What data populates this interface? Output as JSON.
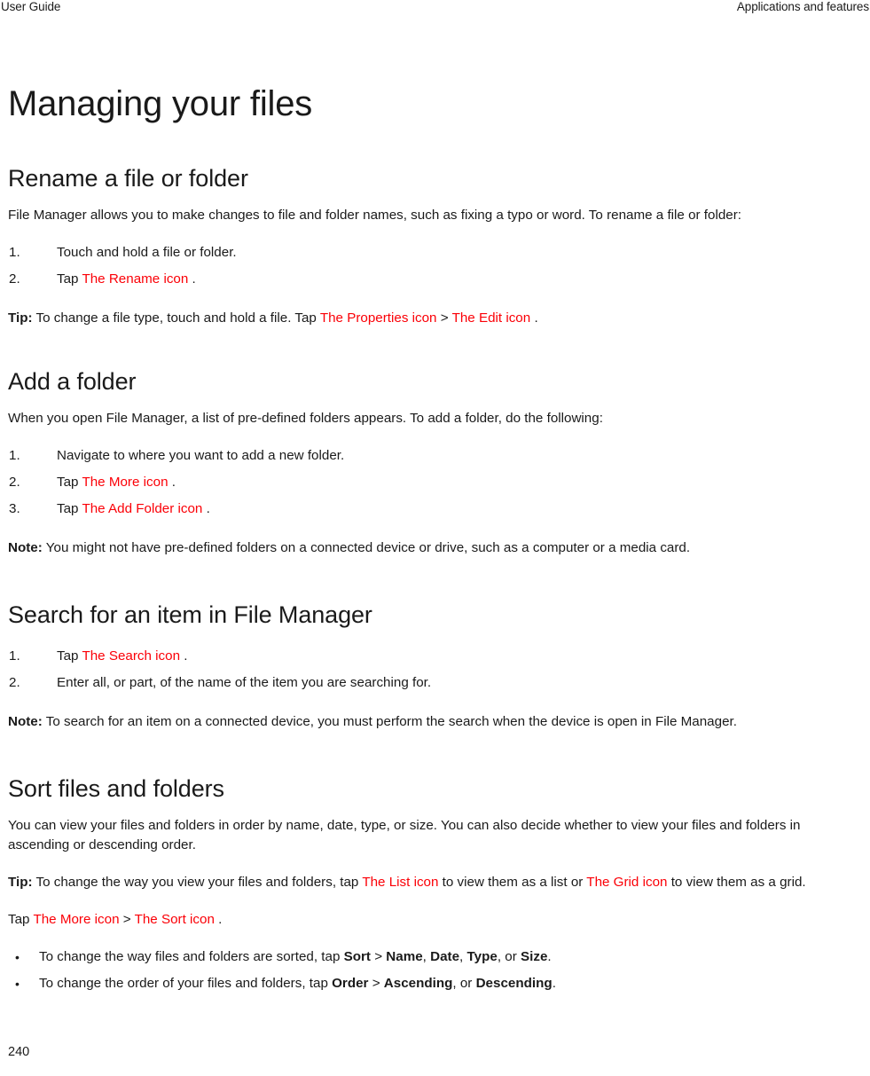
{
  "header": {
    "left": "User Guide",
    "right": "Applications and features"
  },
  "page_title": "Managing your files",
  "colors": {
    "icon_reference_red": "#fb0007",
    "body_text": "#1a1a1a",
    "background": "#ffffff"
  },
  "sections": {
    "rename": {
      "heading": "Rename a file or folder",
      "intro": "File Manager allows you to make changes to file and folder names, such as fixing a typo or word. To rename a file or folder:",
      "steps": [
        {
          "num": "1.",
          "pre": "Touch and hold a file or folder.",
          "icon": "",
          "post": ""
        },
        {
          "num": "2.",
          "pre": "Tap ",
          "icon": "The Rename icon",
          "post": " ."
        }
      ],
      "tip_label": "Tip:",
      "tip_pre": " To change a file type, touch and hold a file. Tap ",
      "tip_icon1": "The Properties icon",
      "tip_sep": " > ",
      "tip_icon2": "The Edit icon",
      "tip_post": " ."
    },
    "add_folder": {
      "heading": "Add a folder",
      "intro": "When you open File Manager, a list of pre-defined folders appears. To add a folder, do the following:",
      "steps": [
        {
          "num": "1.",
          "pre": "Navigate to where you want to add a new folder.",
          "icon": "",
          "post": ""
        },
        {
          "num": "2.",
          "pre": "Tap ",
          "icon": "The More icon",
          "post": " ."
        },
        {
          "num": "3.",
          "pre": "Tap ",
          "icon": "The Add Folder icon",
          "post": " ."
        }
      ],
      "note_label": "Note:",
      "note_text": " You might not have pre-defined folders on a connected device or drive, such as a computer or a media card."
    },
    "search": {
      "heading": "Search for an item in File Manager",
      "steps": [
        {
          "num": "1.",
          "pre": "Tap ",
          "icon": "The Search icon",
          "post": " ."
        },
        {
          "num": "2.",
          "pre": "Enter all, or part, of the name of the item you are searching for.",
          "icon": "",
          "post": ""
        }
      ],
      "note_label": "Note:",
      "note_text": " To search for an item on a connected device, you must perform the search when the device is open in File Manager."
    },
    "sort": {
      "heading": "Sort files and folders",
      "intro": "You can view your files and folders in order by name, date, type, or size. You can also decide whether to view your files and folders in ascending or descending order.",
      "tip_label": "Tip:",
      "tip_pre": " To change the way you view your files and folders, tap ",
      "tip_icon1": "The List icon",
      "tip_mid": " to view them as a list or ",
      "tip_icon2": "The Grid icon",
      "tip_post": " to view them as a grid.",
      "tap_pre": "Tap ",
      "tap_icon1": "The More icon",
      "tap_sep": " > ",
      "tap_icon2": "The Sort icon",
      "tap_post": " .",
      "bullets": [
        {
          "dot": "•",
          "pre": "To change the way files and folders are sorted, tap ",
          "b1": "Sort",
          "sep1": " > ",
          "b2": "Name",
          "sep2": ", ",
          "b3": "Date",
          "sep3": ", ",
          "b4": "Type",
          "sep4": ", or ",
          "b5": "Size",
          "post": "."
        },
        {
          "dot": "•",
          "pre": "To change the order of your files and folders, tap ",
          "b1": "Order",
          "sep1": " > ",
          "b2": "Ascending",
          "sep2": ", or ",
          "b3": "Descending",
          "sep3": "",
          "b4": "",
          "sep4": "",
          "b5": "",
          "post": "."
        }
      ]
    }
  },
  "footer": {
    "page_number": "240"
  }
}
